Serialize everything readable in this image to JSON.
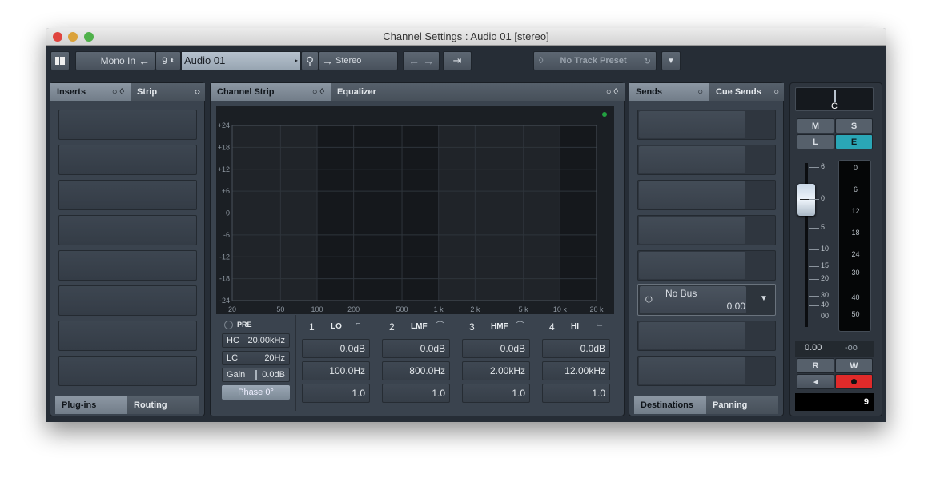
{
  "window": {
    "title": "Channel Settings : Audio 01 [stereo]"
  },
  "toolbar": {
    "input": "Mono In",
    "channel_number": "9",
    "channel_name": "Audio 01",
    "output": "Stereo",
    "preset": "No Track Preset"
  },
  "inserts": {
    "tab1": "Inserts",
    "tab2": "Strip",
    "slots": 8,
    "footer_tabs": [
      "Plug-ins",
      "Routing"
    ]
  },
  "channel_strip": {
    "tab1": "Channel Strip",
    "tab2": "Equalizer"
  },
  "eq_graph": {
    "y_labels": [
      "+24",
      "+18",
      "+12",
      "+6",
      "0",
      "-6",
      "-12",
      "-18",
      "-24"
    ],
    "y_values": [
      24,
      18,
      12,
      6,
      0,
      -6,
      -12,
      -18,
      -24
    ],
    "x_labels": [
      "20",
      "50",
      "100",
      "200",
      "500",
      "1 k",
      "2 k",
      "5 k",
      "10 k",
      "20 k"
    ],
    "x_values": [
      20,
      50,
      100,
      200,
      500,
      1000,
      2000,
      5000,
      10000,
      20000
    ],
    "curve_gain_db": 0,
    "status_led_color": "#22a040"
  },
  "pre": {
    "label": "PRE",
    "hc_label": "HC",
    "hc_value": "20.00kHz",
    "lc_label": "LC",
    "lc_value": "20Hz",
    "gain_label": "Gain",
    "gain_value": "0.0dB",
    "phase": "Phase 0°"
  },
  "bands": [
    {
      "num": "1",
      "name": "LO",
      "gain": "0.0dB",
      "freq": "100.0Hz",
      "q": "1.0",
      "shape": "low-shelf-icon"
    },
    {
      "num": "2",
      "name": "LMF",
      "gain": "0.0dB",
      "freq": "800.0Hz",
      "q": "1.0",
      "shape": "peak-icon"
    },
    {
      "num": "3",
      "name": "HMF",
      "gain": "0.0dB",
      "freq": "2.00kHz",
      "q": "1.0",
      "shape": "peak-icon"
    },
    {
      "num": "4",
      "name": "HI",
      "gain": "0.0dB",
      "freq": "12.00kHz",
      "q": "1.0",
      "shape": "high-shelf-icon"
    }
  ],
  "sends": {
    "tab1": "Sends",
    "tab2": "Cue Sends",
    "slots": 8,
    "active_slot": {
      "name": "No Bus",
      "value": "0.00"
    },
    "footer_tabs": [
      "Destinations",
      "Panning"
    ]
  },
  "fader": {
    "pan": "C",
    "buttons": [
      "M",
      "S",
      "L",
      "E"
    ],
    "scale": [
      "6",
      "0",
      "5",
      "10",
      "15",
      "20",
      "30",
      "40",
      "00"
    ],
    "meter_scale": [
      "0",
      "6",
      "12",
      "18",
      "24",
      "30",
      "40",
      "50"
    ],
    "volume": "0.00",
    "peak": "-oo",
    "rw": [
      "R",
      "W"
    ],
    "channel_number": "9",
    "e_color": "#2aa6b6",
    "record_color": "#e02a2a"
  }
}
